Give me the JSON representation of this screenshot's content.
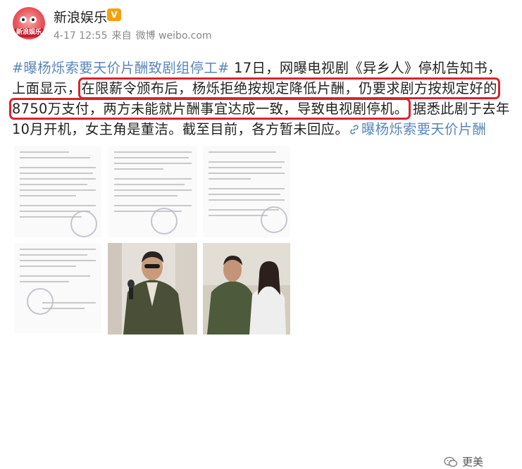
{
  "header": {
    "avatar_label": "新浪娱乐",
    "username": "新浪娱乐",
    "verified_badge": "V",
    "date": "4-17 12:55",
    "source_prefix": "来自",
    "source": "微博 weibo.com"
  },
  "post": {
    "hashtag": "#曝杨烁索要天价片酬致剧组停工#",
    "text_1": " 17日，网曝电视剧《异乡人》停机告知书，上面显示，",
    "highlight_1": "在限薪令颁布后，杨烁拒绝按规定降低片酬，仍要求剧方按规定好的",
    "highlight_2": "8750万支付，两方未能就片酬事宜达成一致，导致电视剧停机。",
    "text_2": " 据悉此剧于去年10月开机，女主角是董洁。截至目前，各方暂未回应。",
    "link_text": "曝杨烁索要天价片酬"
  },
  "watermark": {
    "text": "更美",
    "icon": "wechat-icon"
  },
  "colors": {
    "link": "#5a86b8",
    "highlight_border": "#d9232e"
  }
}
